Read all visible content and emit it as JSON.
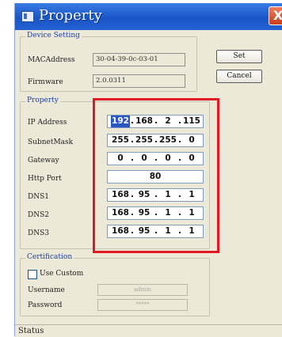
{
  "window": {
    "title": "Property",
    "close_glyph": "X"
  },
  "device": {
    "group_title": "Device Setting",
    "mac_label": "MACAddress",
    "mac_value": "30-04-39-0c-03-01",
    "firmware_label": "Firmware",
    "firmware_value": "2.0.0311",
    "set_button": "Set",
    "cancel_button": "Cancel"
  },
  "property": {
    "group_title": "Property",
    "ip_label": "IP Address",
    "ip": [
      "192",
      "168",
      "2",
      "115"
    ],
    "subnet_label": "SubnetMask",
    "subnet": [
      "255",
      "255",
      "255",
      "0"
    ],
    "gateway_label": "Gateway",
    "gateway": [
      "0",
      "0",
      "0",
      "0"
    ],
    "http_label": "Http Port",
    "http_port": "80",
    "dns1_label": "DNS1",
    "dns1": [
      "168",
      "95",
      "1",
      "1"
    ],
    "dns2_label": "DNS2",
    "dns2": [
      "168",
      "95",
      "1",
      "1"
    ],
    "dns3_label": "DNS3",
    "dns3": [
      "168",
      "95",
      "1",
      "1"
    ]
  },
  "certification": {
    "group_title": "Certification",
    "use_custom_label": "Use Custom",
    "use_custom_checked": false,
    "username_label": "Username",
    "username_value": "admin",
    "password_label": "Password",
    "password_value": "*****"
  },
  "status": {
    "text": "Status"
  },
  "colors": {
    "highlight": "#e11b22",
    "titlebar": "#1a55c8",
    "selection": "#2a57c6"
  }
}
